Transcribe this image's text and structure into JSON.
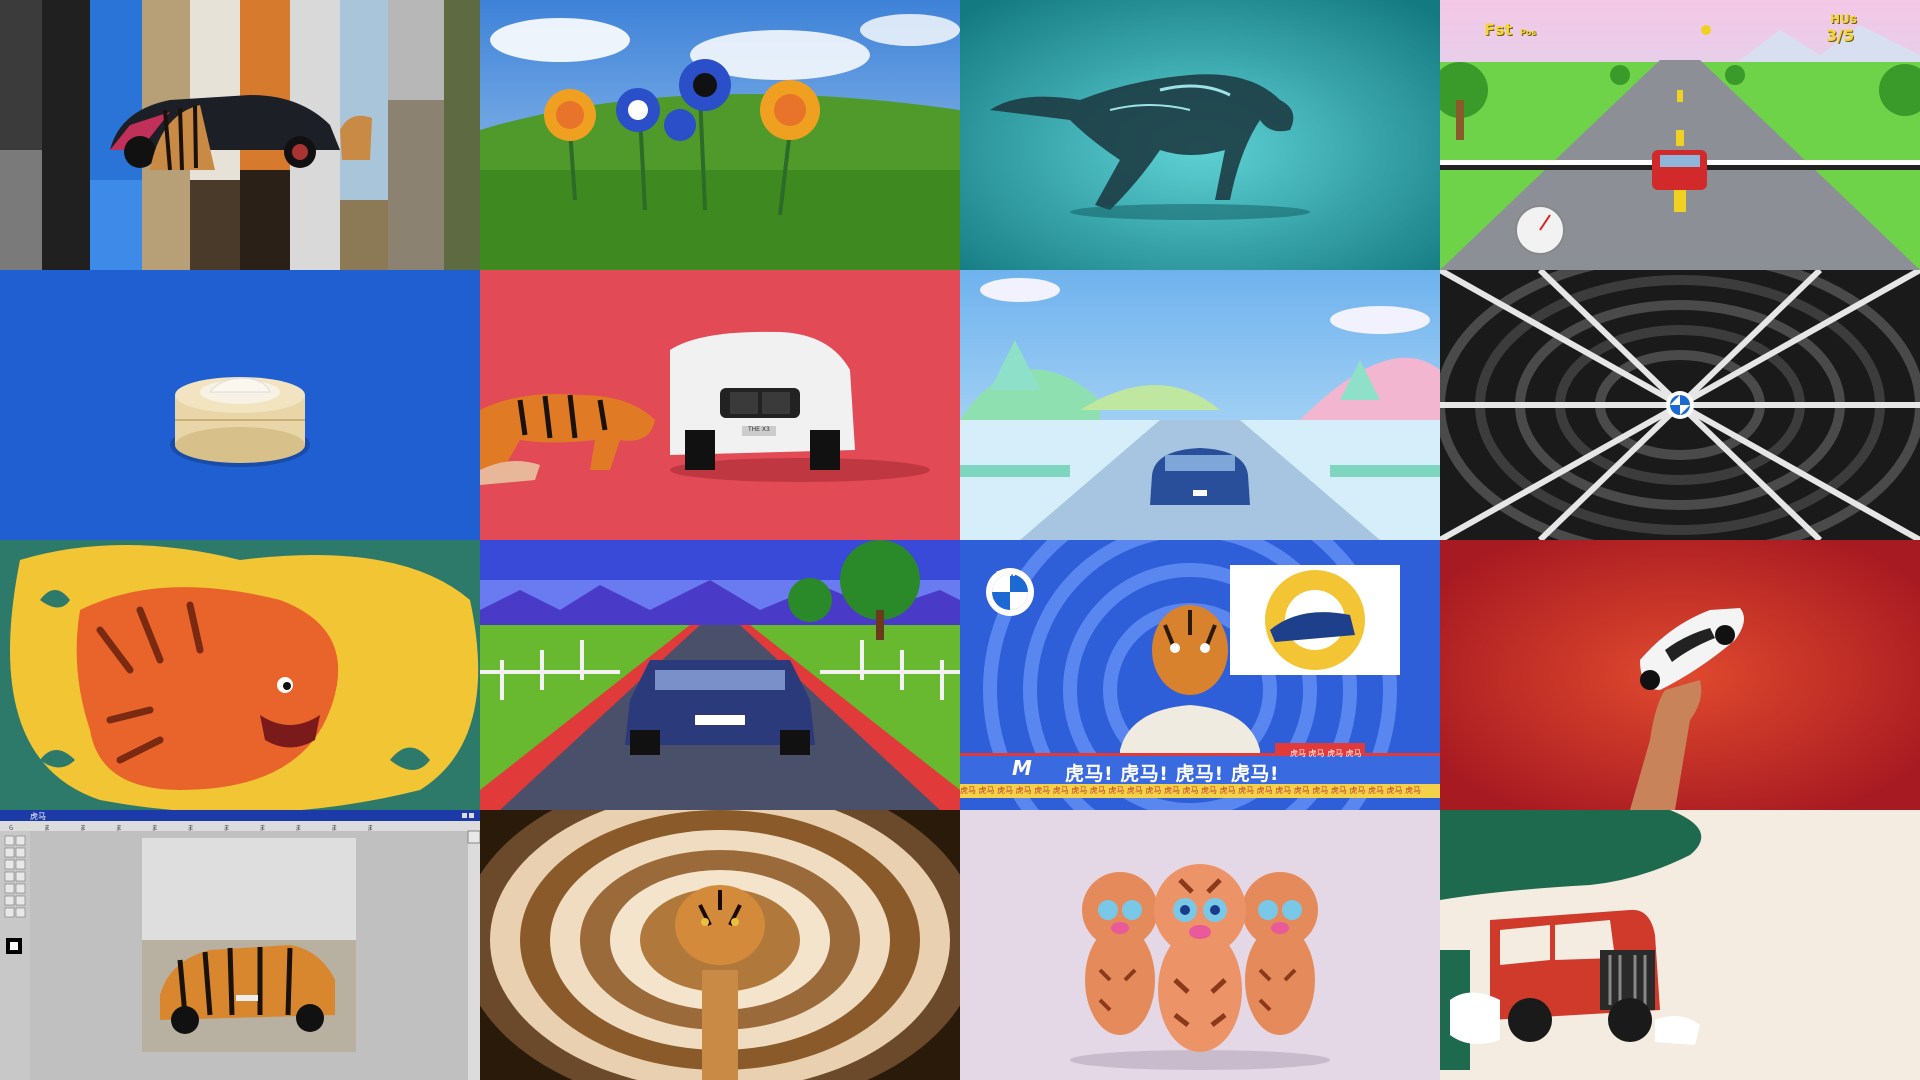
{
  "tiles": [
    {
      "id": 1,
      "name": "mirror-strips-car-tiger"
    },
    {
      "id": 2,
      "name": "tiger-flowers-meadow"
    },
    {
      "id": 3,
      "name": "glass-tiger-running"
    },
    {
      "id": 4,
      "name": "racing-game-road"
    },
    {
      "id": 5,
      "name": "car-dumpling-steamer"
    },
    {
      "id": 6,
      "name": "tiger-and-suv"
    },
    {
      "id": 7,
      "name": "candy-world-car"
    },
    {
      "id": 8,
      "name": "wheel-tunnel"
    },
    {
      "id": 9,
      "name": "illustrated-tiger"
    },
    {
      "id": 10,
      "name": "pixel-race"
    },
    {
      "id": 11,
      "name": "tiger-news-anchor"
    },
    {
      "id": 12,
      "name": "hand-holding-car"
    },
    {
      "id": 13,
      "name": "paint-program-art-car"
    },
    {
      "id": 14,
      "name": "tiger-fur-tunnel"
    },
    {
      "id": 15,
      "name": "three-tiger-figures"
    },
    {
      "id": 16,
      "name": "red-suv-illustration"
    }
  ],
  "racing_hud": {
    "fps_label": "Fst",
    "fps_suffix": "Pos",
    "lap_label": "HUs",
    "lap_value": "3/5"
  },
  "suv_plate": "THE X3",
  "news": {
    "logo": "BMW",
    "m_mark": "M",
    "headline": "虎马! 虎马! 虎马! 虎马!",
    "sub_label": "虎马 虎马 虎马 虎马",
    "ticker": "虎马 虎马 虎马 虎马 虎马 虎马 虎马 虎马 虎马 虎马 虎马 虎马 虎马 虎马 虎马 虎马 虎马 虎马 虎马 虎马 虎马 虎马 虎马 虎马 虎马"
  },
  "paint_window": {
    "title": "虎马",
    "menu": "ら ま ま ま ま ま ま ま ま ま ま"
  },
  "colors": {
    "tiger_orange": "#e8732a",
    "bmw_blue": "#1c69d4",
    "news_blue": "#2f5fd8",
    "red_bg": "#c0262a"
  }
}
